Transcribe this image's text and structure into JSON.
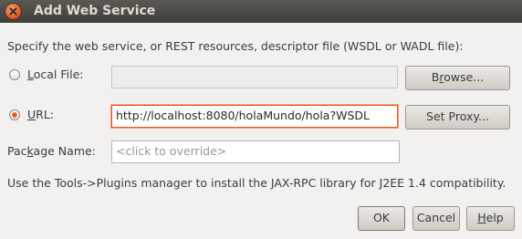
{
  "window": {
    "title": "Add Web Service"
  },
  "description": "Specify the web service, or REST resources, descriptor file (WSDL or WADL file):",
  "local_file": {
    "label_mnemonic": "L",
    "label_rest": "ocal File:",
    "value": "",
    "selected": false,
    "browse_label_pre": "B",
    "browse_label_mnemonic": "r",
    "browse_label_post": "owse..."
  },
  "url": {
    "label_mnemonic": "U",
    "label_rest": "RL:",
    "value": "http://localhost:8080/holaMundo/hola?WSDL",
    "selected": true,
    "set_proxy_label": "Set Proxy..."
  },
  "package": {
    "label_pre": "Pac",
    "label_mnemonic": "k",
    "label_post": "age Name:",
    "placeholder": "<click to override>"
  },
  "info": "Use the Tools->Plugins manager to install the JAX-RPC library for J2EE 1.4 compatibility.",
  "buttons": {
    "ok": "OK",
    "cancel": "Cancel",
    "help_mnemonic": "H",
    "help_rest": "elp"
  },
  "colors": {
    "titlebar": "#3f3e3a",
    "accent": "#e0582a",
    "background": "#f2f1f0"
  },
  "icons": {
    "close": "close-icon",
    "radio_selected": "radio-selected-icon"
  }
}
